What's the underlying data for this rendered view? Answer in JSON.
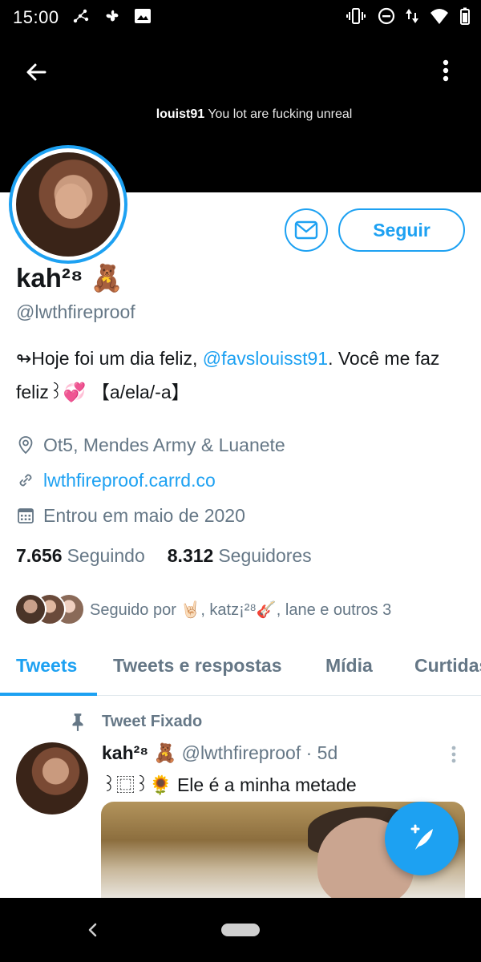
{
  "status_bar": {
    "time": "15:00",
    "icons": [
      "network-activity-icon",
      "fan-icon",
      "image-icon",
      "vibrate-icon",
      "do-not-disturb-icon",
      "data-arrows-icon",
      "wifi-icon",
      "signal-icon",
      "battery-icon"
    ]
  },
  "banner": {
    "caption_user": "louist91",
    "caption_text": "You lot are fucking unreal"
  },
  "profile": {
    "display_name": "kah²⁸ 🧸",
    "handle": "@lwthfireproof",
    "bio_prefix": "↬Hoje foi um dia feliz, ",
    "bio_mention": "@favslouisst91",
    "bio_suffix": ". Você me faz feliz꒱💞 【a/ela/-a】",
    "location": "Ot5, Mendes Army & Luanete",
    "website": "lwthfireproof.carrd.co",
    "joined": "Entrou em maio de 2020",
    "following_count": "7.656",
    "following_label": "Seguindo",
    "followers_count": "8.312",
    "followers_label": "Seguidores",
    "followed_by_text": "Seguido por 🤘🏻, katz¡²⁸🎸, lane e outros 3"
  },
  "actions": {
    "follow_label": "Seguir",
    "message_icon": "mail-icon"
  },
  "tabs": [
    {
      "label": "Tweets",
      "active": true
    },
    {
      "label": "Tweets e respostas",
      "active": false
    },
    {
      "label": "Mídia",
      "active": false
    },
    {
      "label": "Curtidas",
      "active": false
    }
  ],
  "pinned_tweet": {
    "pinned_label": "Tweet Fixado",
    "author_name": "kah²⁸ 🧸",
    "author_handle": "@lwthfireproof",
    "time_ago": "· 5d",
    "text": "꒱⿴꒱🌻 Ele é a minha metade"
  },
  "colors": {
    "accent": "#1da1f2",
    "secondary_text": "#657786",
    "primary_text": "#14171a",
    "banner_bg": "#000000"
  }
}
